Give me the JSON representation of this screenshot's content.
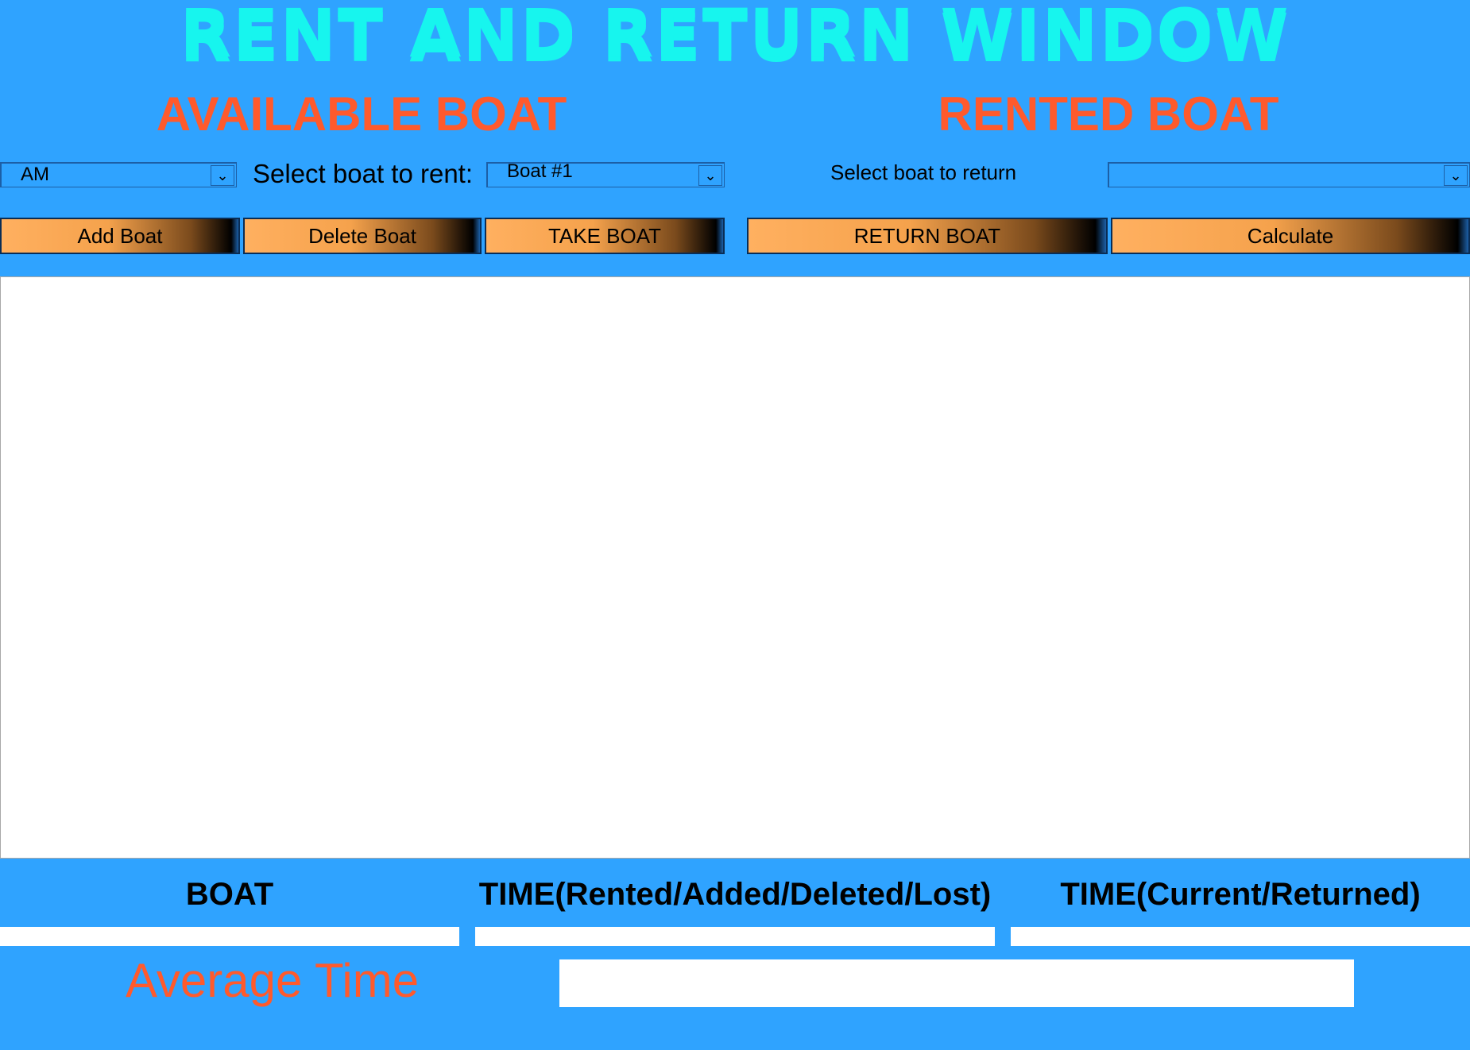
{
  "window": {
    "title": "RENT AND RETURN WINDOW"
  },
  "available": {
    "heading": "AVAILABLE BOAT",
    "period_select_value": "AM",
    "rent_label": "Select boat to rent:",
    "rent_select_value": "Boat #1"
  },
  "rented": {
    "heading": "RENTED BOAT",
    "return_label": "Select boat to return",
    "return_select_value": ""
  },
  "buttons": {
    "add": "Add Boat",
    "delete": "Delete Boat",
    "take": "TAKE BOAT",
    "return": "RETURN  BOAT",
    "calculate": "Calculate"
  },
  "columns": {
    "boat": "BOAT",
    "time_start": "TIME(Rented/Added/Deleted/Lost)",
    "time_end": "TIME(Current/Returned)"
  },
  "fields": {
    "boat_value": "",
    "time_start_value": "",
    "time_end_value": ""
  },
  "average": {
    "label": "Average Time",
    "value": ""
  },
  "icons": {
    "dropdown": "chevron-down-icon"
  },
  "colors": {
    "background": "#2fa3ff",
    "title": "#17f5ee",
    "heading": "#ff5a2c",
    "button_start": "#ffb060",
    "button_end": "#000000"
  }
}
